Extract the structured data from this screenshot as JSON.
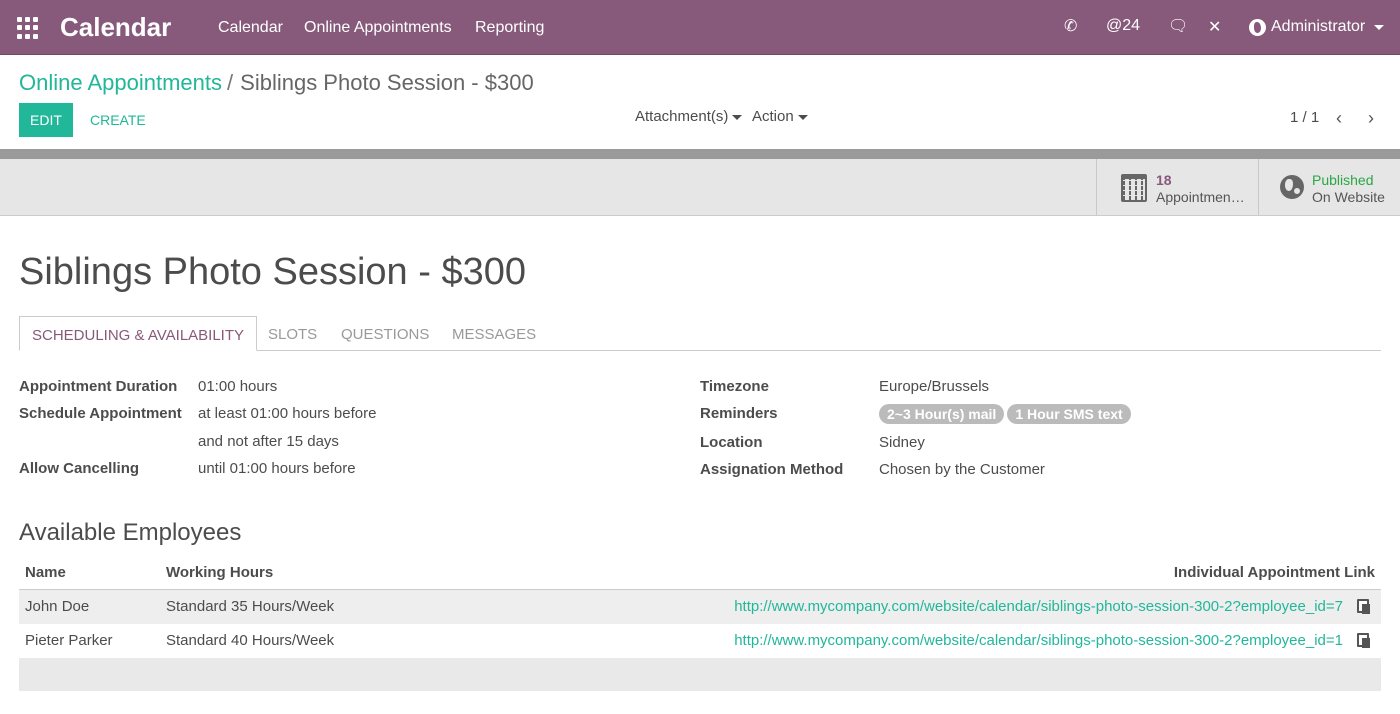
{
  "navbar": {
    "app_title": "Calendar",
    "menus": [
      "Calendar",
      "Online Appointments",
      "Reporting"
    ],
    "mention_count": "24",
    "user_name": "Administrator"
  },
  "breadcrumb": {
    "parent": "Online Appointments",
    "separator": "/",
    "current": "Siblings Photo Session - $300"
  },
  "toolbar": {
    "edit_label": "EDIT",
    "create_label": "CREATE",
    "attachments_label": "Attachment(s)",
    "action_label": "Action",
    "pager": "1 / 1"
  },
  "smart_buttons": {
    "appointments": {
      "value": "18",
      "label": "Appointmen…"
    },
    "published": {
      "value": "Published",
      "label": "On Website"
    }
  },
  "form": {
    "title": "Siblings Photo Session - $300",
    "tabs": [
      "SCHEDULING & AVAILABILITY",
      "SLOTS",
      "QUESTIONS",
      "MESSAGES"
    ],
    "left": {
      "duration_label": "Appointment Duration",
      "duration_value": "01:00 hours",
      "schedule_label": "Schedule Appointment",
      "schedule_value_1": "at least 01:00 hours before",
      "schedule_value_2": "and not after 15 days",
      "cancel_label": "Allow Cancelling",
      "cancel_value": "until 01:00 hours before"
    },
    "right": {
      "timezone_label": "Timezone",
      "timezone_value": "Europe/Brussels",
      "reminders_label": "Reminders",
      "reminders": [
        "2~3 Hour(s) mail",
        "1 Hour SMS text"
      ],
      "location_label": "Location",
      "location_value": "Sidney",
      "assignation_label": "Assignation Method",
      "assignation_value": "Chosen by the Customer"
    }
  },
  "employees": {
    "section_title": "Available Employees",
    "headers": {
      "name": "Name",
      "hours": "Working Hours",
      "link": "Individual Appointment Link"
    },
    "rows": [
      {
        "name": "John Doe",
        "hours": "Standard 35 Hours/Week",
        "link": "http://www.mycompany.com/website/calendar/siblings-photo-session-300-2?employee_id=7"
      },
      {
        "name": "Pieter Parker",
        "hours": "Standard 40 Hours/Week",
        "link": "http://www.mycompany.com/website/calendar/siblings-photo-session-300-2?employee_id=1"
      }
    ]
  },
  "colors": {
    "brand": "#875a7b",
    "accent": "#21b799",
    "published": "#28a745",
    "tag": "#bbbbbb"
  }
}
